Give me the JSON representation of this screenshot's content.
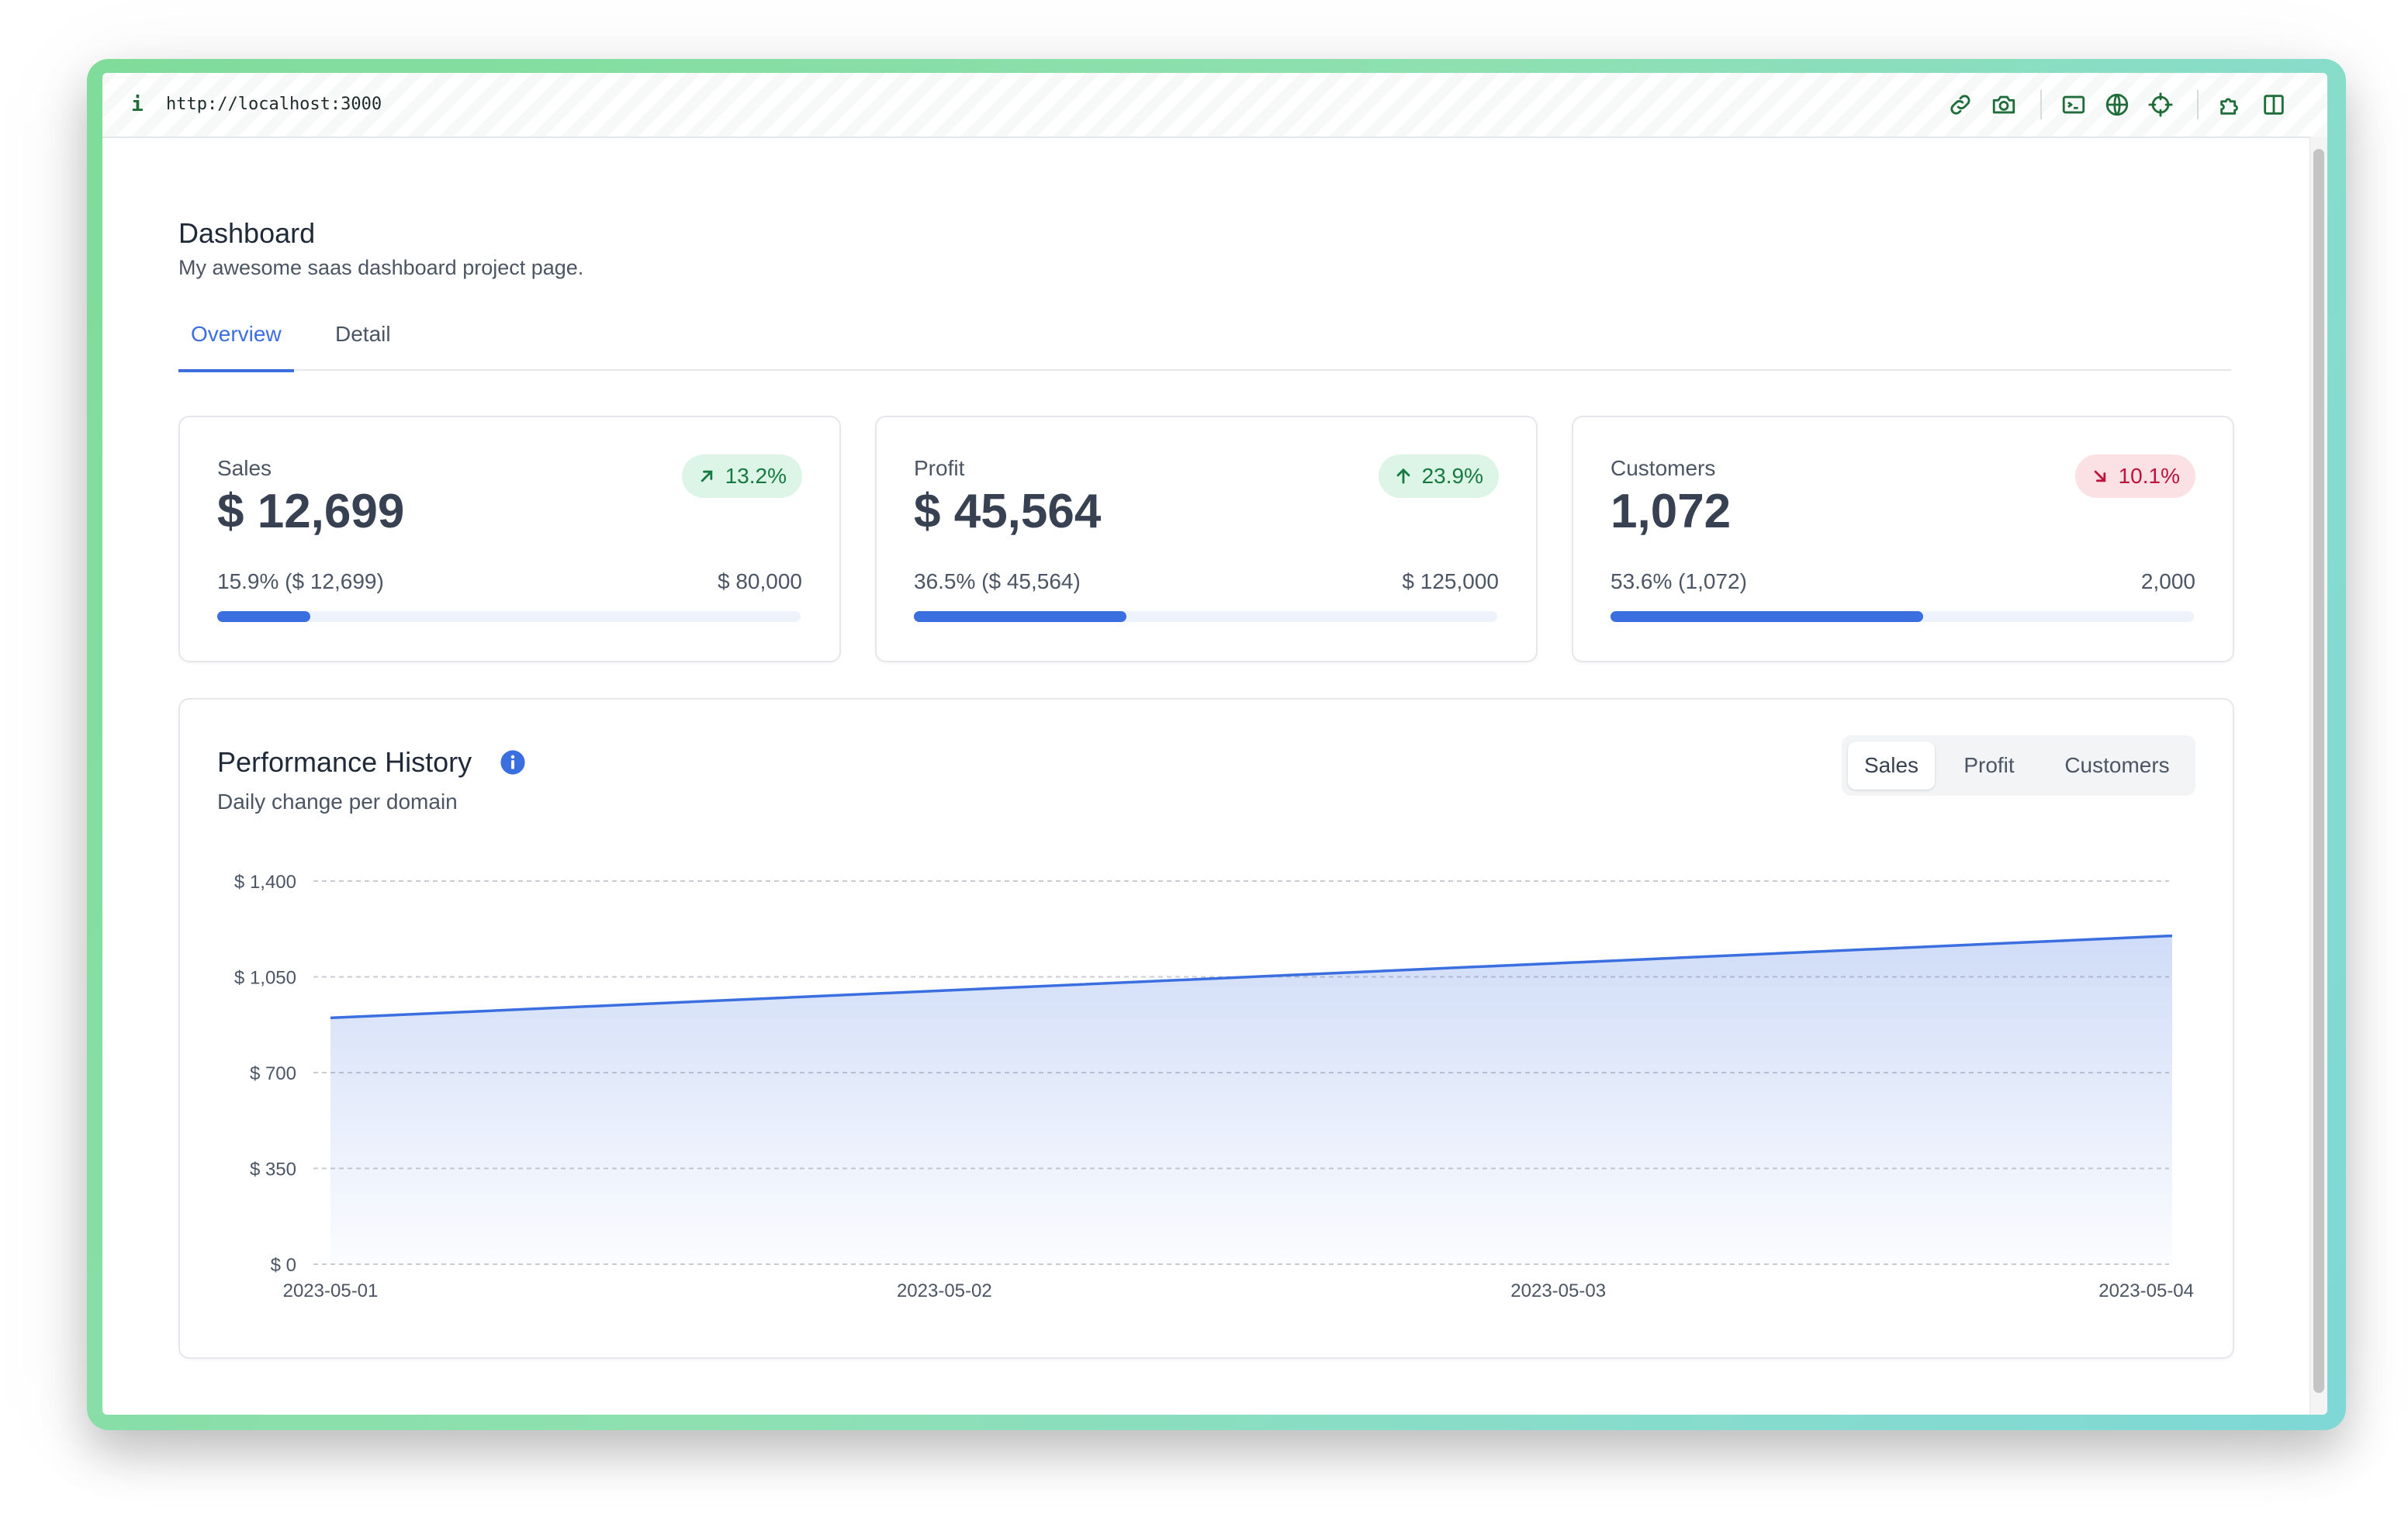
{
  "browser": {
    "url": "http://localhost:3000",
    "icons": [
      "info-icon",
      "link-icon",
      "camera-icon",
      "terminal-icon",
      "globe-icon",
      "crosshair-icon",
      "extension-icon",
      "split-panel-icon"
    ]
  },
  "header": {
    "title": "Dashboard",
    "subtitle": "My awesome saas dashboard project page."
  },
  "tabs": [
    {
      "label": "Overview",
      "active": true
    },
    {
      "label": "Detail",
      "active": false
    }
  ],
  "kpis": [
    {
      "label": "Sales",
      "value": "$ 12,699",
      "badge": "13.2%",
      "trend": "moderate-increase",
      "progress_text": "15.9% ($ 12,699)",
      "target": "$ 80,000",
      "progress": 0.159
    },
    {
      "label": "Profit",
      "value": "$ 45,564",
      "badge": "23.9%",
      "trend": "increase",
      "progress_text": "36.5% ($ 45,564)",
      "target": "$ 125,000",
      "progress": 0.365
    },
    {
      "label": "Customers",
      "value": "1,072",
      "badge": "10.1%",
      "trend": "moderate-decrease",
      "progress_text": "53.6% (1,072)",
      "target": "2,000",
      "progress": 0.536
    }
  ],
  "performance": {
    "title": "Performance History",
    "subtitle": "Daily change per domain",
    "segments": [
      {
        "label": "Sales",
        "active": true
      },
      {
        "label": "Profit",
        "active": false
      },
      {
        "label": "Customers",
        "active": false
      }
    ]
  },
  "colors": {
    "accent": "#3b6fe0",
    "increase": "#177a43",
    "decrease": "#be123c"
  },
  "chart_data": {
    "type": "area",
    "x": [
      "2023-05-01",
      "2023-05-02",
      "2023-05-03",
      "2023-05-04"
    ],
    "series": [
      {
        "values": [
          900,
          1000,
          1100,
          1200
        ]
      }
    ],
    "yticks": [
      "$ 0",
      "$ 350",
      "$ 700",
      "$ 1,050",
      "$ 1,400"
    ],
    "ylim": [
      0,
      1400
    ],
    "grid": true,
    "color": "#3b6fe0"
  }
}
